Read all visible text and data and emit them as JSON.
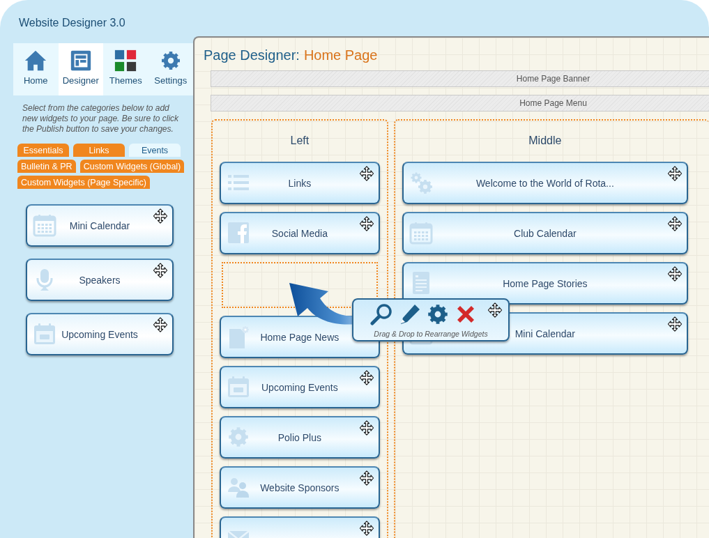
{
  "app": {
    "title": "Website Designer 3.0"
  },
  "nav": [
    {
      "label": "Home",
      "kind": "home",
      "selected": false
    },
    {
      "label": "Designer",
      "kind": "layout",
      "selected": true
    },
    {
      "label": "Themes",
      "kind": "swatches",
      "selected": false
    },
    {
      "label": "Settings",
      "kind": "gear",
      "selected": false
    }
  ],
  "instructions": "Select from the categories below to add new widgets to your page. Be sure to click the Publish button to save your changes.",
  "categories": [
    {
      "label": "Essentials",
      "selected": false
    },
    {
      "label": "Links",
      "selected": false
    },
    {
      "label": "Events",
      "selected": true
    },
    {
      "label": "Bulletin & PR",
      "selected": false
    },
    {
      "label": "Custom Widgets (Global)",
      "selected": false
    },
    {
      "label": "Custom Widgets (Page Specific)",
      "selected": false
    }
  ],
  "palette": [
    {
      "label": "Mini Calendar",
      "kind": "calendar-grid"
    },
    {
      "label": "Speakers",
      "kind": "microphone"
    },
    {
      "label": "Upcoming Events",
      "kind": "calendar-date"
    }
  ],
  "designer": {
    "title": "Page Designer:",
    "page": "Home Page",
    "bars": [
      "Home Page Banner",
      "Home Page Menu"
    ],
    "columns": [
      {
        "title": "Left",
        "items": [
          {
            "kind": "list",
            "label": "Links"
          },
          {
            "kind": "facebook",
            "label": "Social Media"
          },
          {
            "kind": "placeholder"
          },
          {
            "kind": "news",
            "label": "Home Page News"
          },
          {
            "kind": "calendar-date",
            "label": "Upcoming Events"
          },
          {
            "kind": "gear",
            "label": "Polio Plus"
          },
          {
            "kind": "people",
            "label": "Website Sponsors"
          },
          {
            "kind": "envelope"
          }
        ]
      },
      {
        "title": "Middle",
        "items": [
          {
            "kind": "gears",
            "label": "Welcome to the World of Rota..."
          },
          {
            "kind": "calendar-grid",
            "label": "Club Calendar"
          },
          {
            "kind": "document",
            "label": "Home Page Stories"
          },
          {
            "kind": "calendar-grid",
            "label": "Mini Calendar"
          }
        ]
      }
    ]
  },
  "toolbar": {
    "caption": "Drag & Drop to Rearrange Widgets"
  }
}
